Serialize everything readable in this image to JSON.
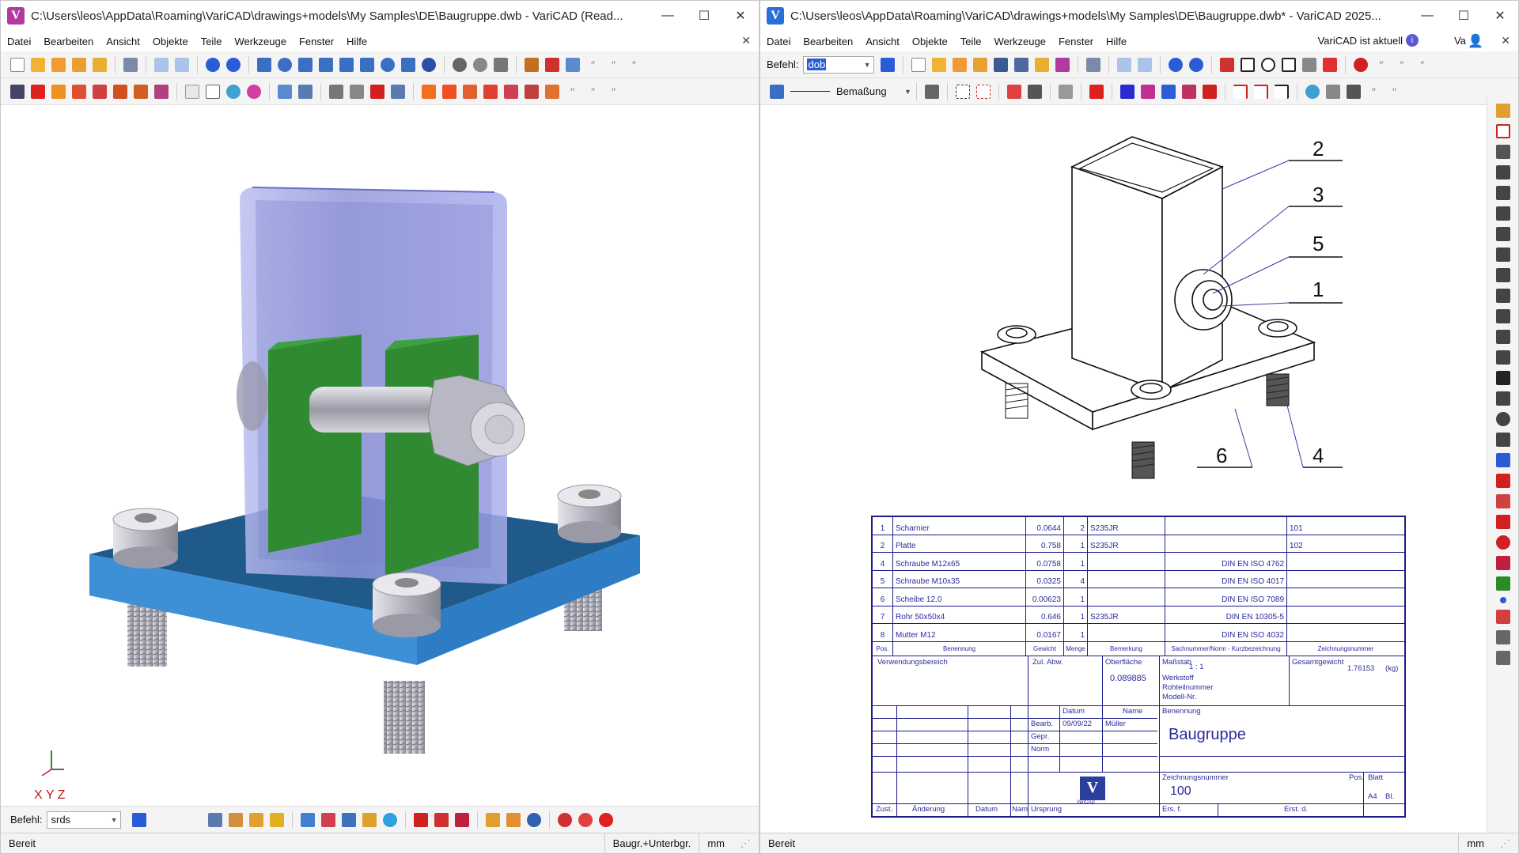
{
  "colors": {
    "accent": "#2a5cd6",
    "bom_ink": "#1c1c8c",
    "logo_left": "#b23a9f",
    "logo_right": "#2a6fd6",
    "glass": "#9aa0e0",
    "green_part": "#2f8a32",
    "base_plate": "#3d8fd6"
  },
  "left_window": {
    "title": "C:\\Users\\leos\\AppData\\Roaming\\VariCAD\\drawings+models\\My Samples\\DE\\Baugruppe.dwb - VariCAD (Read...",
    "menu": [
      "Datei",
      "Bearbeiten",
      "Ansicht",
      "Objekte",
      "Teile",
      "Werkzeuge",
      "Fenster",
      "Hilfe"
    ],
    "axes_label": "X Y Z",
    "command": {
      "label": "Befehl:",
      "value": "srds"
    },
    "status": {
      "main": "Bereit",
      "mode": "Baugr.+Unterbgr.",
      "unit": "mm"
    }
  },
  "right_window": {
    "title": "C:\\Users\\leos\\AppData\\Roaming\\VariCAD\\drawings+models\\My Samples\\DE\\Baugruppe.dwb* - VariCAD 2025...",
    "menu": [
      "Datei",
      "Bearbeiten",
      "Ansicht",
      "Objekte",
      "Teile",
      "Werkzeuge",
      "Fenster",
      "Hilfe"
    ],
    "update_notice": "VariCAD ist aktuell",
    "user": "Va",
    "command": {
      "label": "Befehl:",
      "value": "dob"
    },
    "layer_label": "Bemaßung",
    "status": {
      "main": "Bereit",
      "unit": "mm"
    },
    "balloons": [
      "2",
      "3",
      "5",
      "1",
      "6",
      "4"
    ],
    "bom": {
      "rows": [
        {
          "pos": "1",
          "name": "Scharnier",
          "weight": "0.0644",
          "qty": "2",
          "material": "S235JR",
          "norm": "",
          "drawing": "101"
        },
        {
          "pos": "2",
          "name": "Platte",
          "weight": "0.758",
          "qty": "1",
          "material": "S235JR",
          "norm": "",
          "drawing": "102"
        },
        {
          "pos": "4",
          "name": "Schraube M12x65",
          "weight": "0.0758",
          "qty": "1",
          "material": "",
          "norm": "DIN EN ISO 4762",
          "drawing": ""
        },
        {
          "pos": "5",
          "name": "Schraube M10x35",
          "weight": "0.0325",
          "qty": "4",
          "material": "",
          "norm": "DIN EN ISO 4017",
          "drawing": ""
        },
        {
          "pos": "6",
          "name": "Scheibe 12.0",
          "weight": "0.00623",
          "qty": "1",
          "material": "",
          "norm": "DIN EN ISO 7089",
          "drawing": ""
        },
        {
          "pos": "7",
          "name": "Rohr 50x50x4",
          "weight": "0.646",
          "qty": "1",
          "material": "S235JR",
          "norm": "DIN EN 10305-5",
          "drawing": ""
        },
        {
          "pos": "8",
          "name": "Mutter M12",
          "weight": "0.0167",
          "qty": "1",
          "material": "",
          "norm": "DIN EN ISO 4032",
          "drawing": ""
        }
      ],
      "headers": {
        "pos": "Pos.",
        "name": "Benennung",
        "weight": "Gewicht",
        "qty": "Menge",
        "material": "Bemerkung",
        "norm": "Sachnummer/Norm - Kurzbezeichnung",
        "drawing": "Zeichnungsnummer"
      }
    },
    "title_block": {
      "verwendung": "Verwendungsbereich",
      "zul_abw": "Zul. Abw.",
      "oberflaeche": "Oberfläche",
      "oberflaeche_val": "0.089885",
      "massstab": "Maßstab",
      "massstab_val": "1 : 1",
      "gesamtgewicht": "Gesamtgewicht",
      "gesamtgewicht_val": "1.76153",
      "kg": "(kg)",
      "werkstoff": "Werkstoff",
      "rohteilnummer": "Rohteilnummer",
      "modell_nr": "Modell-Nr.",
      "datum": "Datum",
      "name": "Name",
      "benennung": "Benennung",
      "bearb": "Bearb.",
      "bearb_datum": "09/09/22",
      "bearb_name": "Müller",
      "gepr": "Gepr.",
      "norm": "Norm",
      "title": "Baugruppe",
      "zeichnungsnummer": "Zeichnungsnummer",
      "zeichnungsnummer_val": "100",
      "pos": "Pos.",
      "blatt": "Blatt",
      "format": "A4",
      "bl": "Bl.",
      "zust": "Zust.",
      "aenderung": "Änderung",
      "datum2": "Datum",
      "nam": "Nam",
      "ursprung": "Ursprung",
      "ers_f": "Ers. f.",
      "ers_d": "Erst. d.",
      "logo_text": "VariCAD"
    }
  }
}
